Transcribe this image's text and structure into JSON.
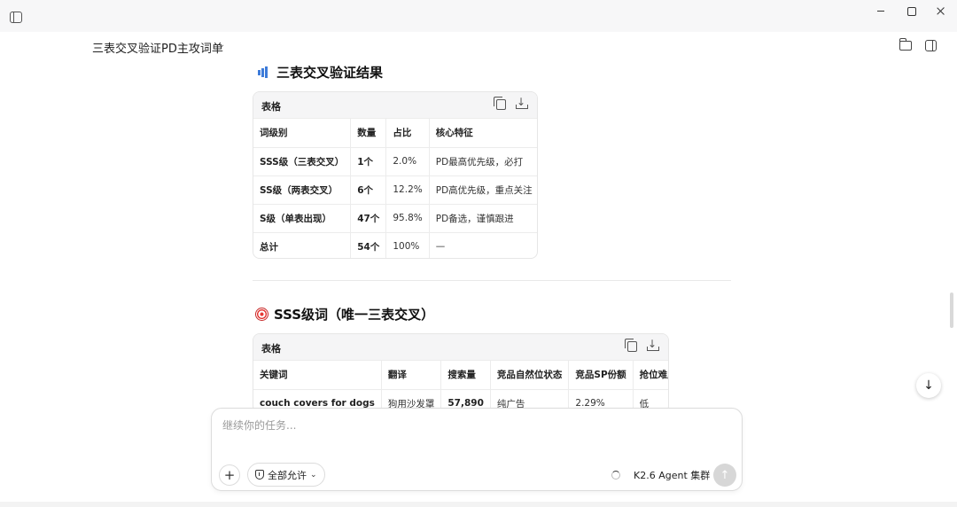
{
  "header": {
    "doc_title": "三表交叉验证PD主攻词单"
  },
  "section1": {
    "heading": "三表交叉验证结果",
    "table_label": "表格",
    "columns": [
      "词级别",
      "数量",
      "占比",
      "核心特征"
    ],
    "rows": [
      [
        "SSS级（三表交叉）",
        "1个",
        "2.0%",
        "PD最高优先级，必打"
      ],
      [
        "SS级（两表交叉）",
        "6个",
        "12.2%",
        "PD高优先级，重点关注"
      ],
      [
        "S级（单表出现）",
        "47个",
        "95.8%",
        "PD备选，谨慎跟进"
      ],
      [
        "总计",
        "54个",
        "100%",
        "—"
      ]
    ]
  },
  "section2": {
    "heading": "SSS级词（唯一三表交叉）",
    "table_label": "表格",
    "columns": [
      "关键词",
      "翻译",
      "搜索量",
      "竞品自然位状态",
      "竞品SP份额",
      "抢位难度"
    ],
    "rows": [
      [
        "couch covers for dogs",
        "狗用沙发罩",
        "57,890",
        "纯广告",
        "2.29%",
        "低"
      ]
    ]
  },
  "input": {
    "placeholder": "继续你的任务...",
    "permission_label": "全部允许",
    "model_label": "K2.6 Agent 集群"
  },
  "icons": {
    "sidebar_toggle": "sidebar-toggle-icon",
    "folder": "folder-icon",
    "panel": "panel-icon",
    "copy": "copy-icon",
    "download": "download-icon",
    "scroll_down": "arrow-down-icon",
    "send": "arrow-up-icon"
  }
}
